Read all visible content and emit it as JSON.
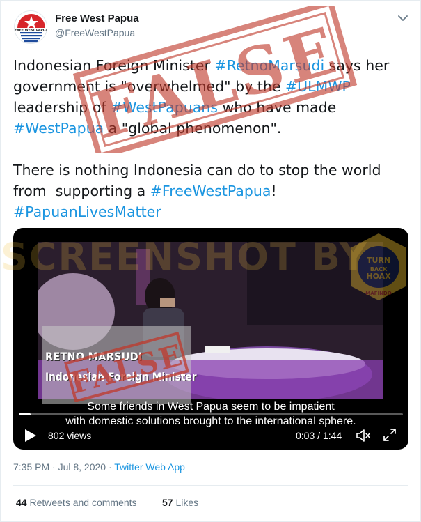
{
  "colors": {
    "link": "#1b95e0",
    "text": "#14171a",
    "muted": "#657786",
    "stamp": "#c0392b"
  },
  "author": {
    "name": "Free West Papua",
    "handle": "@FreeWestPapua",
    "avatar_label": "FREE WEST PAPUA"
  },
  "tweet": {
    "line1_pre": "Indonesian Foreign Minister ",
    "line1_tag": "#RetnoMarsudi",
    "line1_post": " says her",
    "line2_pre": "government is \"overwhelmed\" by the ",
    "line2_tag": "#ULMWP",
    "line3_pre": "leadership of ",
    "line3_tag": "#WestPapuans",
    "line3_post": " who have made",
    "line4_tag": "#WestPapua",
    "line4_post": " a \"global phenomenon\".",
    "line6": "There is nothing Indonesia can do to stop the world",
    "line7_pre": "from  supporting a ",
    "line7_tag": "#FreeWestPapua",
    "line7_post": "!",
    "line8_tag": "#PapuanLivesMatter"
  },
  "stamp": {
    "text": "FALSE"
  },
  "watermark": {
    "text": "SCREENSHOT BY",
    "badge_top": "TURN",
    "badge_mid": "BACK",
    "badge_bottom": "HOAX",
    "badge_org": "MAFINDO"
  },
  "video": {
    "lower_third_name": "RETNO MARSUDI",
    "lower_third_title": "Indonesian Foreign Minister",
    "subtitle_line1": "Some friends in West Papua seem to be impatient",
    "subtitle_line2": "with domestic solutions brought to the international sphere.",
    "views": "802 views",
    "time": "0:03 / 1:44",
    "progress_fraction": 0.03
  },
  "meta": {
    "time": "7:35 PM · Jul 8, 2020 · ",
    "source": "Twitter Web App"
  },
  "stats": {
    "retweets_count": "44",
    "retweets_label": " Retweets and comments",
    "likes_count": "57",
    "likes_label": " Likes"
  }
}
